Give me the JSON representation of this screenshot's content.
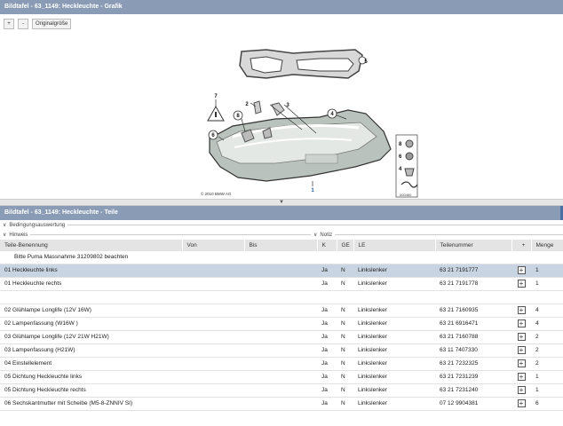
{
  "graphic_title": "Bildtafel - 63_1149: Heckleuchte - Grafik",
  "toolbar": {
    "zoom_in": "+",
    "zoom_out": "-",
    "original_size": "Originalgröße"
  },
  "graphic": {
    "callouts": [
      "5",
      "7",
      "2",
      "3",
      "4",
      "8",
      "6",
      "1",
      "8",
      "6",
      "4"
    ],
    "copyright": "© 2010 BMW AG",
    "figure_id": "000460"
  },
  "parts_title": "Bildtafel - 63_1149: Heckleuchte - Teile",
  "sections": {
    "conditions": "Bedingungsauswertung",
    "hints": "Hinweis",
    "notes": "Notiz"
  },
  "table": {
    "headers": [
      "Teile-Benennung",
      "Von",
      "Bis",
      "K",
      "GE",
      "LE",
      "Teilenummer",
      "+",
      "Menge"
    ],
    "note": "Bitte Puma Massnahme 31209802 beachten",
    "rows": [
      {
        "name": "01 Heckleuchte links",
        "k": "Ja",
        "ge": "N",
        "le": "Linkslenker",
        "pn": "63 21 7191777",
        "qty": "1",
        "selected": true
      },
      {
        "name": "01 Heckleuchte rechts",
        "k": "Ja",
        "ge": "N",
        "le": "Linkslenker",
        "pn": "63 21 7191778",
        "qty": "1"
      },
      {
        "empty": true
      },
      {
        "name": "02 Glühlampe Longlife (12V 16W)",
        "k": "Ja",
        "ge": "N",
        "le": "Linkslenker",
        "pn": "63 21 7160935",
        "qty": "4"
      },
      {
        "name": "02 Lampenfassung (W16W )",
        "k": "Ja",
        "ge": "N",
        "le": "Linkslenker",
        "pn": "63 21 6916471",
        "qty": "4"
      },
      {
        "name": "03 Glühlampe Longlife (12V 21W H21W)",
        "k": "Ja",
        "ge": "N",
        "le": "Linkslenker",
        "pn": "63 21 7160788",
        "qty": "2"
      },
      {
        "name": "03 Lampenfassung (H21W)",
        "k": "Ja",
        "ge": "N",
        "le": "Linkslenker",
        "pn": "63 11 7407330",
        "qty": "2"
      },
      {
        "name": "04 Einstellelement",
        "k": "Ja",
        "ge": "N",
        "le": "Linkslenker",
        "pn": "63 21 7232325",
        "qty": "2"
      },
      {
        "name": "05 Dichtung Heckleuchte links",
        "k": "Ja",
        "ge": "N",
        "le": "Linkslenker",
        "pn": "63 21 7231239",
        "qty": "1"
      },
      {
        "name": "05 Dichtung Heckleuchte rechts",
        "k": "Ja",
        "ge": "N",
        "le": "Linkslenker",
        "pn": "63 21 7231240",
        "qty": "1"
      },
      {
        "name": "06 Sechskantmutter mit Scheibe (M5-8-ZNNIV SI)",
        "k": "Ja",
        "ge": "N",
        "le": "Linkslenker",
        "pn": "07 12 9904381",
        "qty": "6"
      }
    ]
  }
}
